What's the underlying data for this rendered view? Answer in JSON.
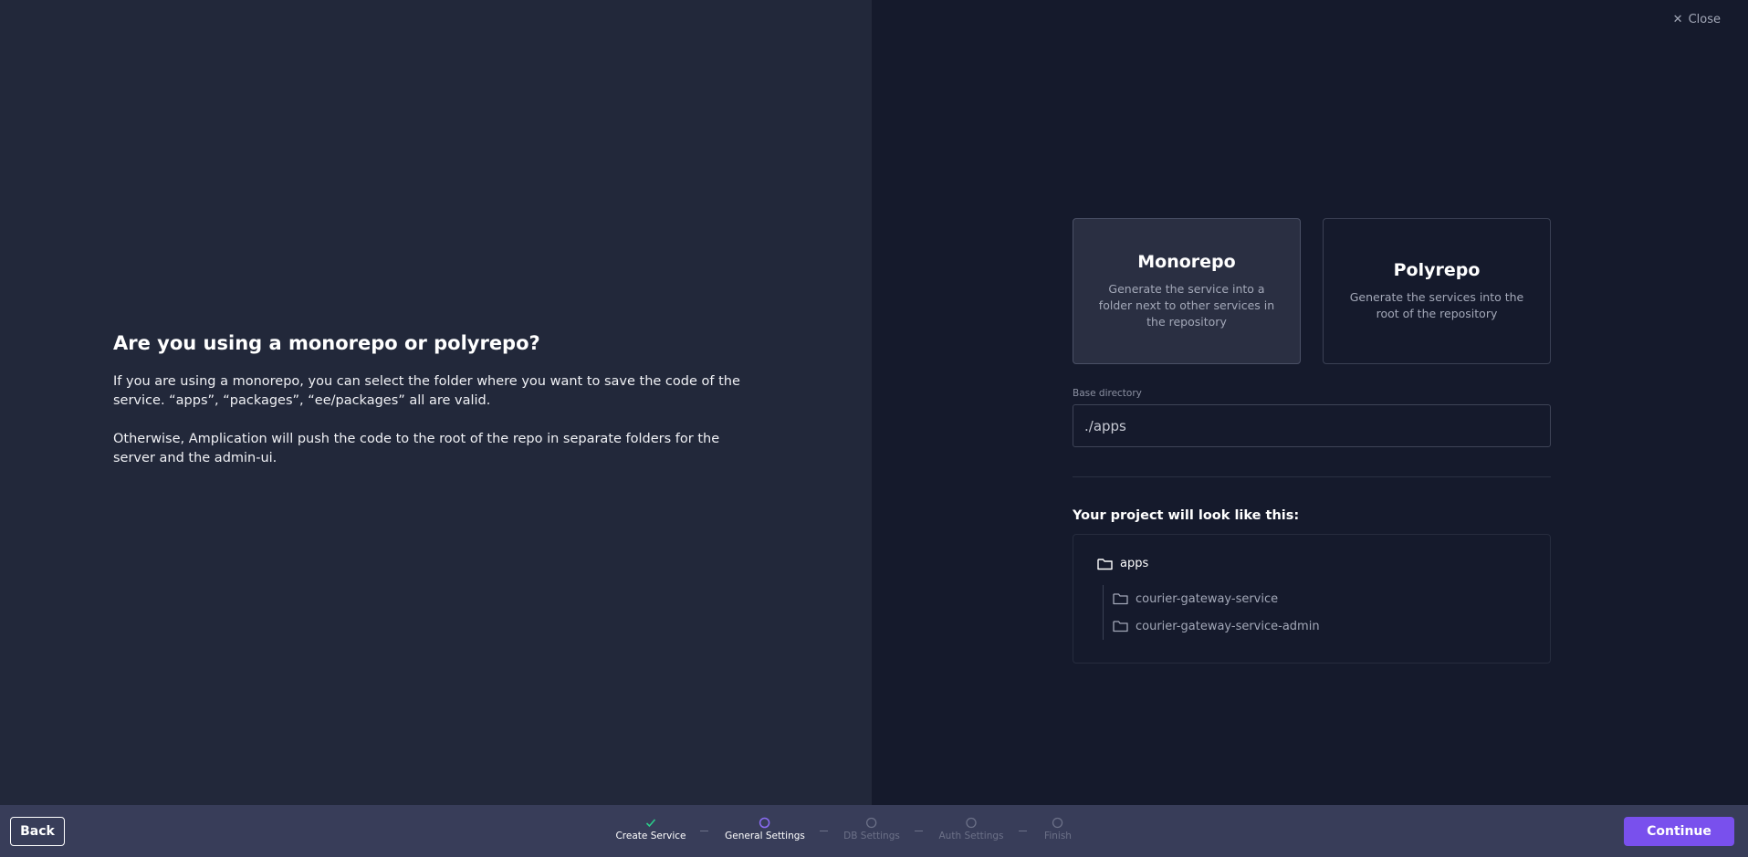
{
  "close": {
    "label": "Close"
  },
  "intro": {
    "title": "Are you using a monorepo or polyrepo?",
    "paragraph1": "If you are using a monorepo, you can select the folder where you want to save the code of the service. “apps”, “packages”, “ee/packages” all are valid.",
    "paragraph2": "Otherwise, Amplication will push the code to the root of the repo in separate folders for the server and the admin-ui."
  },
  "options": {
    "monorepo": {
      "title": "Monorepo",
      "description": "Generate the service into a folder next to other services in the repository",
      "selected": true
    },
    "polyrepo": {
      "title": "Polyrepo",
      "description": "Generate the services into the root of the repository",
      "selected": false
    }
  },
  "base_directory": {
    "label": "Base directory",
    "value": "./apps",
    "placeholder": ""
  },
  "preview": {
    "heading": "Your project will look like this:",
    "root_folder": "apps",
    "children": [
      "courier-gateway-service",
      "courier-gateway-service-admin"
    ]
  },
  "footer": {
    "back_label": "Back",
    "continue_label": "Continue",
    "steps": [
      {
        "label": "Create Service",
        "status": "done"
      },
      {
        "label": "General Settings",
        "status": "active"
      },
      {
        "label": "DB Settings",
        "status": "pending"
      },
      {
        "label": "Auth Settings",
        "status": "pending"
      },
      {
        "label": "Finish",
        "status": "pending"
      }
    ]
  },
  "colors": {
    "accent": "#7950ed",
    "step_done": "#2bcd8a",
    "left_panel_bg": "#22283a",
    "right_panel_bg": "#151a2c",
    "footer_bg": "#383d59"
  }
}
